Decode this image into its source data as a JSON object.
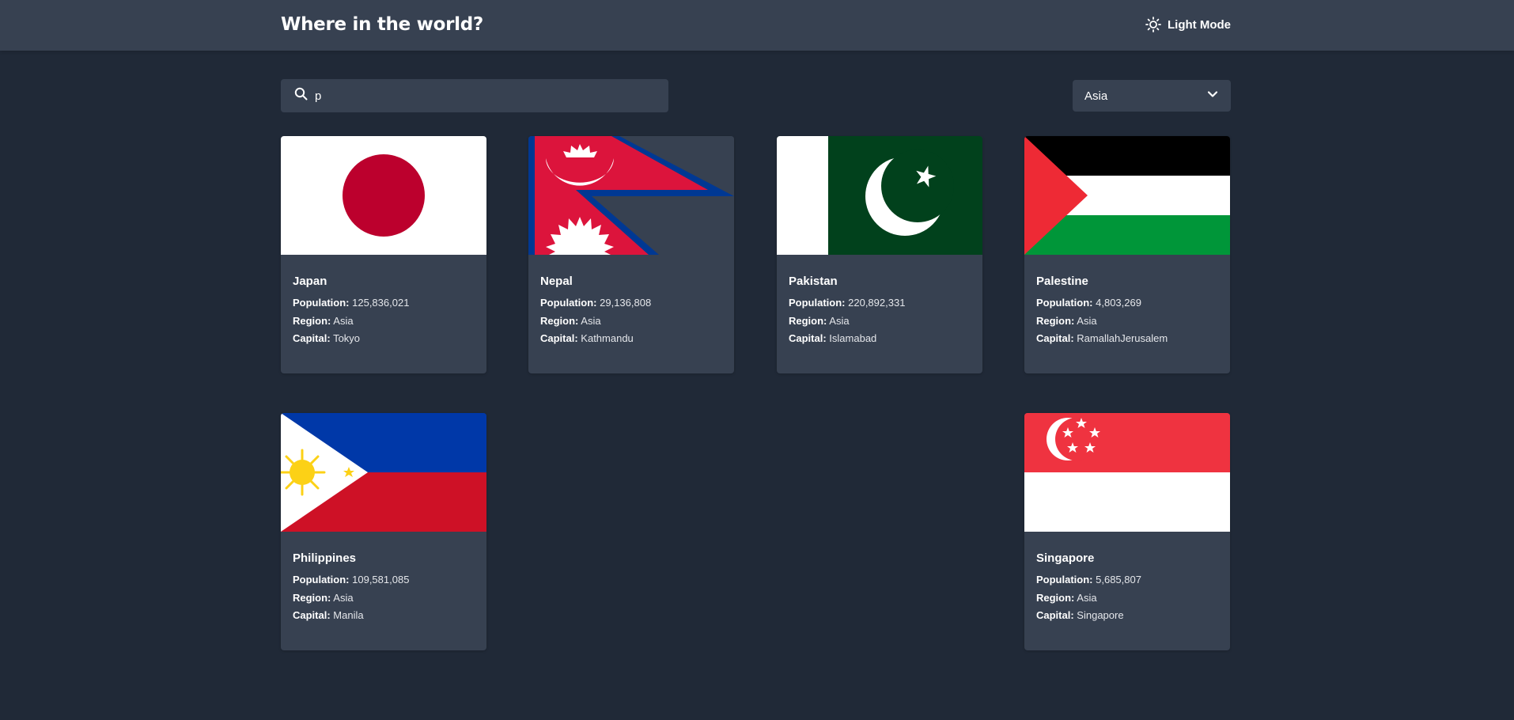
{
  "header": {
    "title": "Where in the world?",
    "mode_label": "Light Mode",
    "mode_icon": "sun-icon"
  },
  "search": {
    "value": "p",
    "placeholder": "Search for a country...",
    "icon": "search-icon"
  },
  "filter": {
    "selected": "Asia",
    "icon": "chevron-down-icon"
  },
  "labels": {
    "population": "Population:",
    "region": "Region:",
    "capital": "Capital:"
  },
  "countries": [
    {
      "name": "Japan",
      "population": "125,836,021",
      "region": "Asia",
      "capital": "Tokyo",
      "flag": "japan-flag"
    },
    {
      "name": "Nepal",
      "population": "29,136,808",
      "region": "Asia",
      "capital": "Kathmandu",
      "flag": "nepal-flag"
    },
    {
      "name": "Pakistan",
      "population": "220,892,331",
      "region": "Asia",
      "capital": "Islamabad",
      "flag": "pakistan-flag"
    },
    {
      "name": "Palestine",
      "population": "4,803,269",
      "region": "Asia",
      "capital": "RamallahJerusalem",
      "flag": "palestine-flag"
    },
    {
      "name": "Philippines",
      "population": "109,581,085",
      "region": "Asia",
      "capital": "Manila",
      "flag": "philippines-flag"
    },
    {
      "name": "Singapore",
      "population": "5,685,807",
      "region": "Asia",
      "capital": "Singapore",
      "flag": "singapore-flag"
    }
  ],
  "colors": {
    "background": "#202937",
    "surface": "#374151",
    "text": "#ffffff"
  }
}
